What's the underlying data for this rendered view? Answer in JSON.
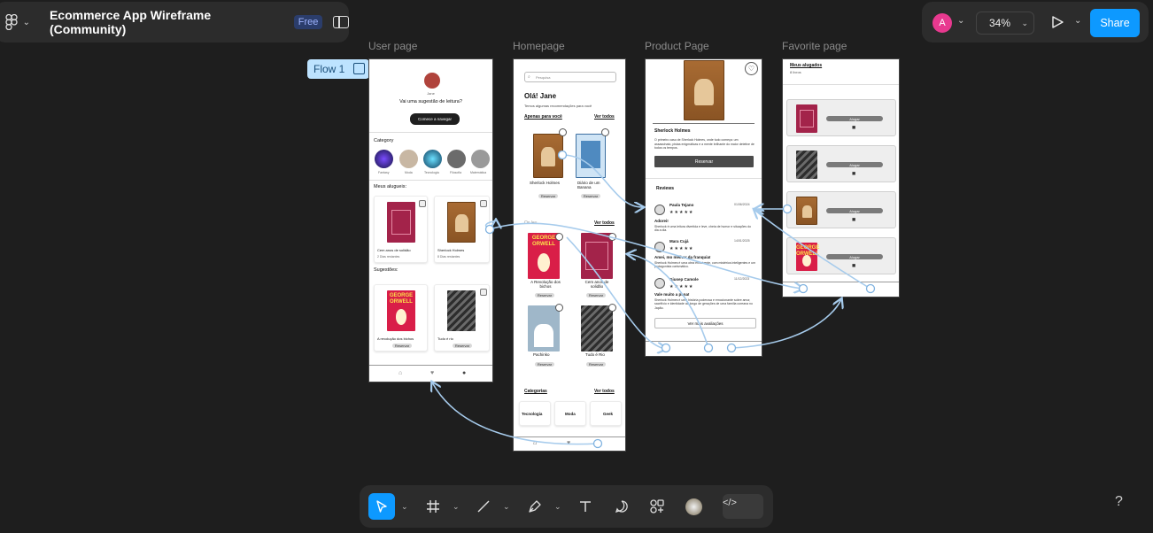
{
  "app": {
    "file_title": "Ecommerce App Wireframe (Community)",
    "plan_badge": "Free",
    "user_initial": "A",
    "zoom": "34%",
    "share_label": "Share",
    "help_label": "?",
    "accent": "#0d99ff"
  },
  "canvas": {
    "flow_tag": "Flow 1",
    "frames": {
      "user": {
        "label": "User page",
        "user_name": "Jane",
        "prompt": "Vai uma sugestão de leitura?",
        "cta": "Comece a navegar",
        "category_heading": "Category",
        "categories": [
          "Fantasy",
          "Moda",
          "Tecnologia",
          "Filosofia",
          "Matemática"
        ],
        "rented_heading": "Meus alugueis:",
        "rented": [
          {
            "title": "Cem anos de solidão",
            "meta": "2 Dias restantes"
          },
          {
            "title": "Sherlock Holmes",
            "meta": "8 Dias restantes"
          }
        ],
        "suggest_heading": "Sugestões:",
        "suggestions": [
          {
            "title": "A revolução dos bichos",
            "action": "Reservar"
          },
          {
            "title": "Tudo é rio",
            "action": "Reservar"
          }
        ]
      },
      "home": {
        "label": "Homepage",
        "search_placeholder": "Pesquisa",
        "greeting": "Olá! Jane",
        "subtitle": "Temos algumas recomendações para você",
        "section1": "Apenas para você",
        "see_all": "Ver todos",
        "section1_books": [
          {
            "title": "Sherlock Holmes",
            "action": "Reservar"
          },
          {
            "title": "Diário de um Banana",
            "action": "Reservar"
          }
        ],
        "section2": "Os leu",
        "section2_books": [
          {
            "title": "A Revolução dos bichos",
            "action": "Reservar"
          },
          {
            "title": "Cem anos de solidão",
            "action": "Reservar"
          },
          {
            "title": "Pachinko",
            "action": "Reservar"
          },
          {
            "title": "Tudo é Rio",
            "action": "Reservar"
          }
        ],
        "categories_heading": "Categorias",
        "categories": [
          "Tecnologia",
          "Moda",
          "Geek"
        ]
      },
      "product": {
        "label": "Product Page",
        "book_title": "Sherlock Holmes",
        "description": "O primeiro caso de Sherlock Holmes, onde tudo começa: um assassinato, pistas enigmáticas e a mente brilhante do maior detetive de todos os tempos.",
        "reserve": "Reservar",
        "reviews_heading": "Reviews",
        "reviews": [
          {
            "name": "Paula Tejano",
            "date": "01/06/2024",
            "headline": "Adorei!",
            "text": "Sherlock é uma leitura divertida e leve, cheia de humor e situações do dia a dia."
          },
          {
            "name": "Mara Cujá",
            "date": "14/01/2025",
            "headline": "Amei, mo melhor da franquia!",
            "text": "Sherlock Holmes é uma obra envolvente, com mistérios inteligentes e um protagonista carismático."
          },
          {
            "name": "Giusep Camole",
            "date": "11/12/2023",
            "headline": "Vale muito a pena!",
            "text": "Sherlock Holmes é uma história poderosa e emocionante sobre amor, sacrifício e identidade ao longo de gerações de uma família coreana no Japão."
          }
        ],
        "more_reviews": "Ver mais avaliações",
        "stars": "★★★★★"
      },
      "favorite": {
        "label": "Favorite page",
        "heading": "Meus alugados",
        "count": "8 livros",
        "action": "Alugar"
      }
    }
  },
  "bottom_toolbar": {
    "tools": [
      "move-tool",
      "frame-tool",
      "line-tool",
      "pen-tool",
      "text-tool",
      "comment-tool",
      "components-tool",
      "actions-tool",
      "dev-mode-tool"
    ]
  }
}
